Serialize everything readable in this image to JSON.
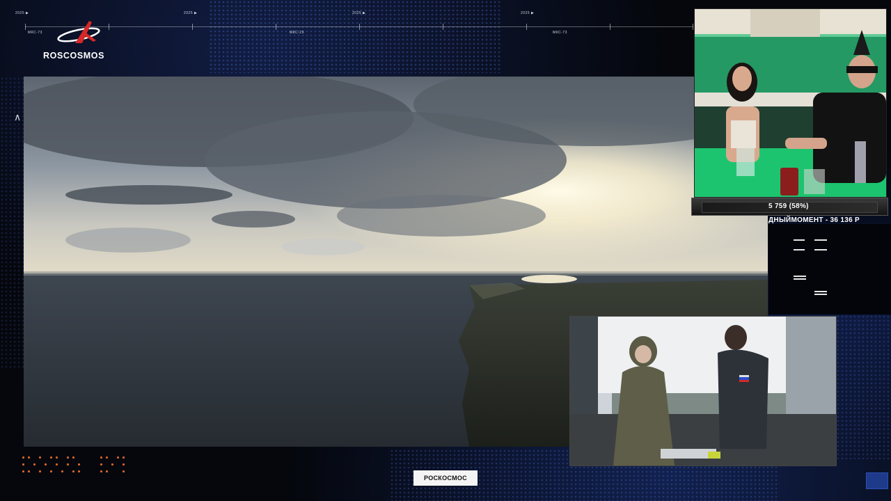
{
  "brand": {
    "logo_text": "ROSCOSMOS",
    "bottom_label": "РОСКОСМОС"
  },
  "timeline": {
    "labels": [
      "МКС-73",
      "МКС-29",
      "МКС-73"
    ],
    "top_marks": [
      "2025 ▶",
      "2025 ▶",
      "2025 ▶",
      "2025 ▶"
    ]
  },
  "overlay": {
    "progress": "5 759 (58%)",
    "donation": "ДНЫЙМОМЕНТ - 36 136 Р"
  },
  "colors": {
    "background": "#05070d",
    "accent_blue": "#2a4fd0",
    "brand_red": "#d62828",
    "orange_dots": "#d8642b"
  },
  "icons": {
    "side_arrow": "chevron-up-icon",
    "logo": "roscosmos-logo-icon"
  }
}
